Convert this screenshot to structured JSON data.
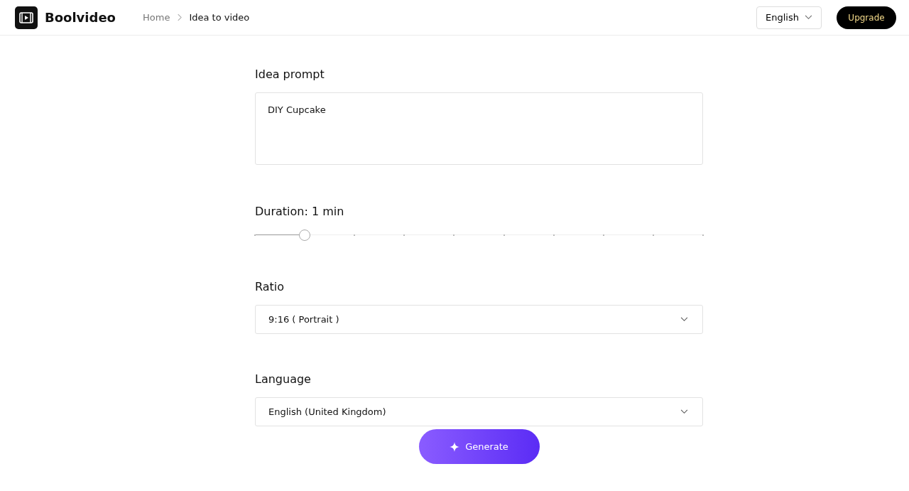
{
  "header": {
    "brand": "Boolvideo",
    "breadcrumb": [
      "Home",
      "Idea to video"
    ],
    "language": "English",
    "upgrade": "Upgrade"
  },
  "prompt": {
    "label": "Idea prompt",
    "value": "DIY Cupcake"
  },
  "duration": {
    "label": "Duration: 1 min",
    "level": 0.111
  },
  "ratio": {
    "label": "Ratio",
    "value": "9:16 ( Portrait )"
  },
  "language": {
    "label": "Language",
    "value": "English (United Kingdom)"
  },
  "generate": "Generate"
}
